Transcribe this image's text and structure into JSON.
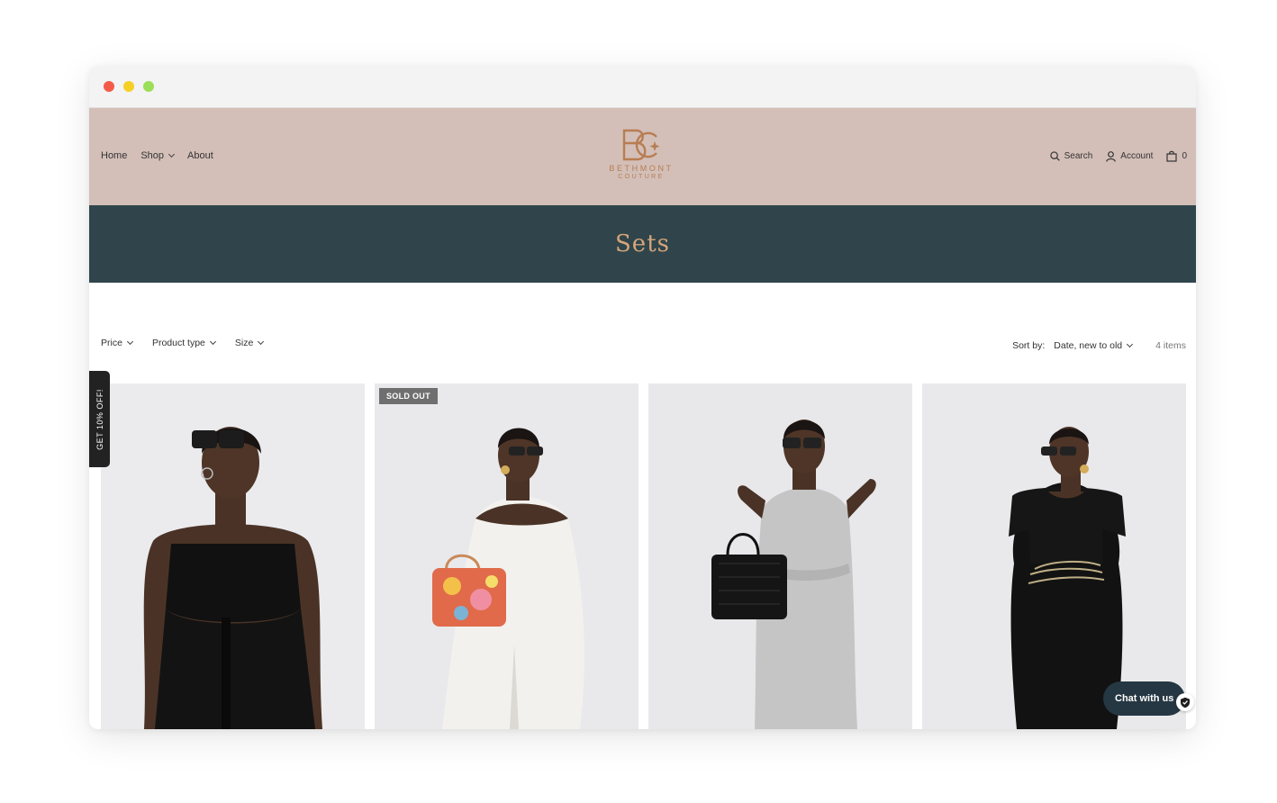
{
  "nav": {
    "left": [
      {
        "label": "Home",
        "has_dropdown": false
      },
      {
        "label": "Shop",
        "has_dropdown": true
      },
      {
        "label": "About",
        "has_dropdown": false
      }
    ],
    "search_label": "Search",
    "account_label": "Account",
    "cart_count": "0"
  },
  "brand": {
    "monogram": "BC",
    "name": "BETHMONT",
    "subname": "COUTURE",
    "color": "#b87d52"
  },
  "collection": {
    "title": "Sets"
  },
  "filters": [
    {
      "label": "Price"
    },
    {
      "label": "Product type"
    },
    {
      "label": "Size"
    }
  ],
  "sort": {
    "label": "Sort by:",
    "value": "Date, new to old",
    "item_count": "4 items"
  },
  "products": [
    {
      "image": "woman in black strapless jumpsuit",
      "badge": ""
    },
    {
      "image": "woman in white off-shoulder jumpsuit with floral handbag",
      "badge": "SOLD OUT"
    },
    {
      "image": "woman in grey sleeveless jumpsuit with black croc handbag",
      "badge": ""
    },
    {
      "image": "woman in black jumpsuit with chain belt",
      "badge": ""
    }
  ],
  "promo": {
    "label": "GET 10% OFF!"
  },
  "chat": {
    "label": "Chat with us"
  },
  "colors": {
    "header_bg": "#d3bfb8",
    "hero_bg": "#2f454b",
    "hero_title": "#d6a47a",
    "chat_bg": "#253742"
  }
}
